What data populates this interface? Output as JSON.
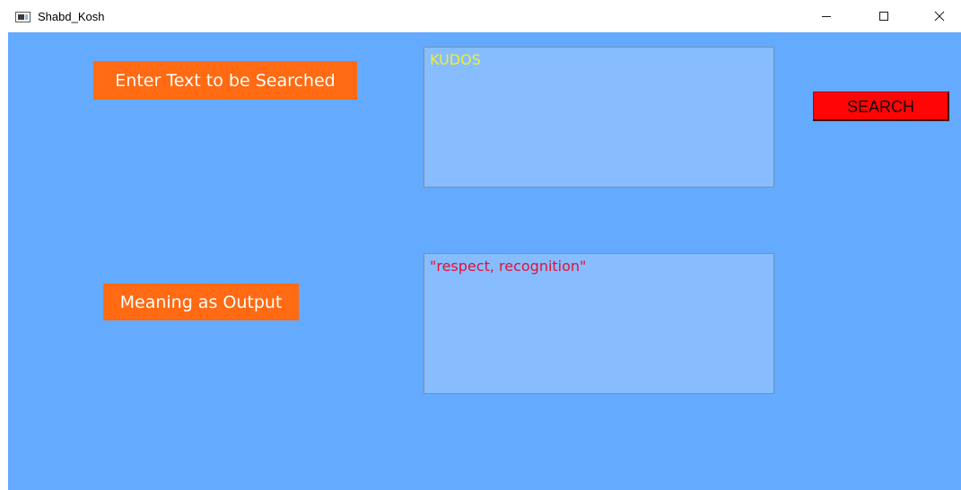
{
  "window": {
    "title": "Shabd_Kosh",
    "icons": {
      "app": "app-window-icon",
      "minimize": "minimize-icon",
      "maximize": "maximize-icon",
      "close": "close-icon"
    }
  },
  "form": {
    "search_label": "Enter Text to be Searched",
    "output_label": "Meaning as Output",
    "input_value": "KUDOS",
    "output_value": "\"respect, recognition\"",
    "search_button": "SEARCH"
  },
  "colors": {
    "background": "#64aaff",
    "label_bg": "#ff6a13",
    "textbox_bg": "#87bdff",
    "input_text": "#f2ee2c",
    "output_text": "#e0103a",
    "button_bg": "#ff0505"
  }
}
